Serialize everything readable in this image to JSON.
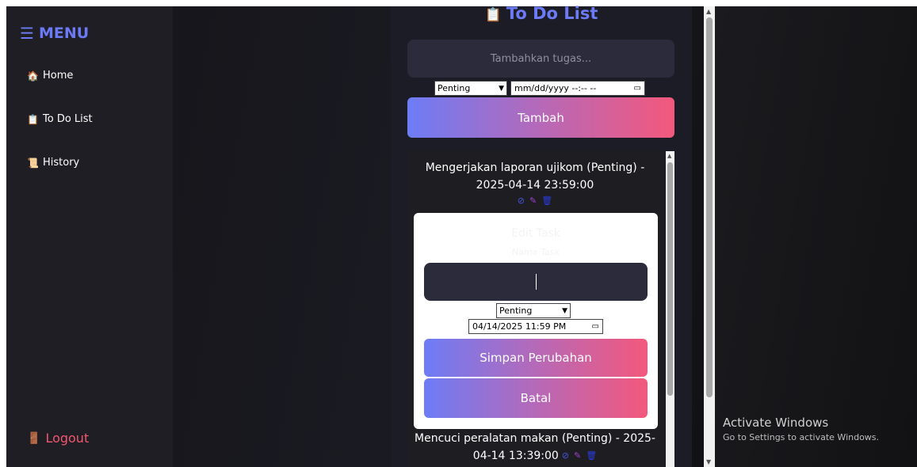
{
  "sidebar": {
    "title": "MENU",
    "items": [
      {
        "icon": "🏠",
        "label": "Home"
      },
      {
        "icon": "📋",
        "label": "To Do List"
      },
      {
        "icon": "📜",
        "label": "History"
      }
    ],
    "logout": {
      "icon": "🚪",
      "label": "Logout"
    }
  },
  "todo": {
    "title": "To Do List",
    "title_icon": "📋",
    "task_input_placeholder": "Tambahkan tugas...",
    "priority_selected": "Penting",
    "date_placeholder": "mm/dd/yyyy --:-- --",
    "add_button": "Tambah"
  },
  "tasks": [
    {
      "text": "Mengerjakan laporan ujikom (Penting) - 2025-04-14 23:59:00",
      "line1": "Mengerjakan laporan ujikom (Penting) -",
      "line2": "2025-04-14 23:59:00"
    },
    {
      "text": "Mencuci peralatan makan (Penting) - 2025-04-14 13:39:00",
      "line1": "Mencuci peralatan makan (Penting) - 2025-",
      "line2": "04-14 13:39:00"
    }
  ],
  "actions": {
    "complete_icon": "⊘",
    "edit_icon": "✎",
    "delete_icon": "🗑"
  },
  "edit_modal": {
    "title": "Edit Task",
    "subtitle": "Nama Task",
    "priority_selected": "Penting",
    "datetime_value": "04/14/2025 11:59 PM",
    "save_button": "Simpan Perubahan",
    "cancel_button": "Batal"
  },
  "watermark": {
    "line1": "Activate Windows",
    "line2": "Go to Settings to activate Windows."
  },
  "colors": {
    "accent": "#6c7bf5",
    "logout": "#f0566f",
    "gradient_start": "#6d7cf6",
    "gradient_end": "#f3587c"
  }
}
